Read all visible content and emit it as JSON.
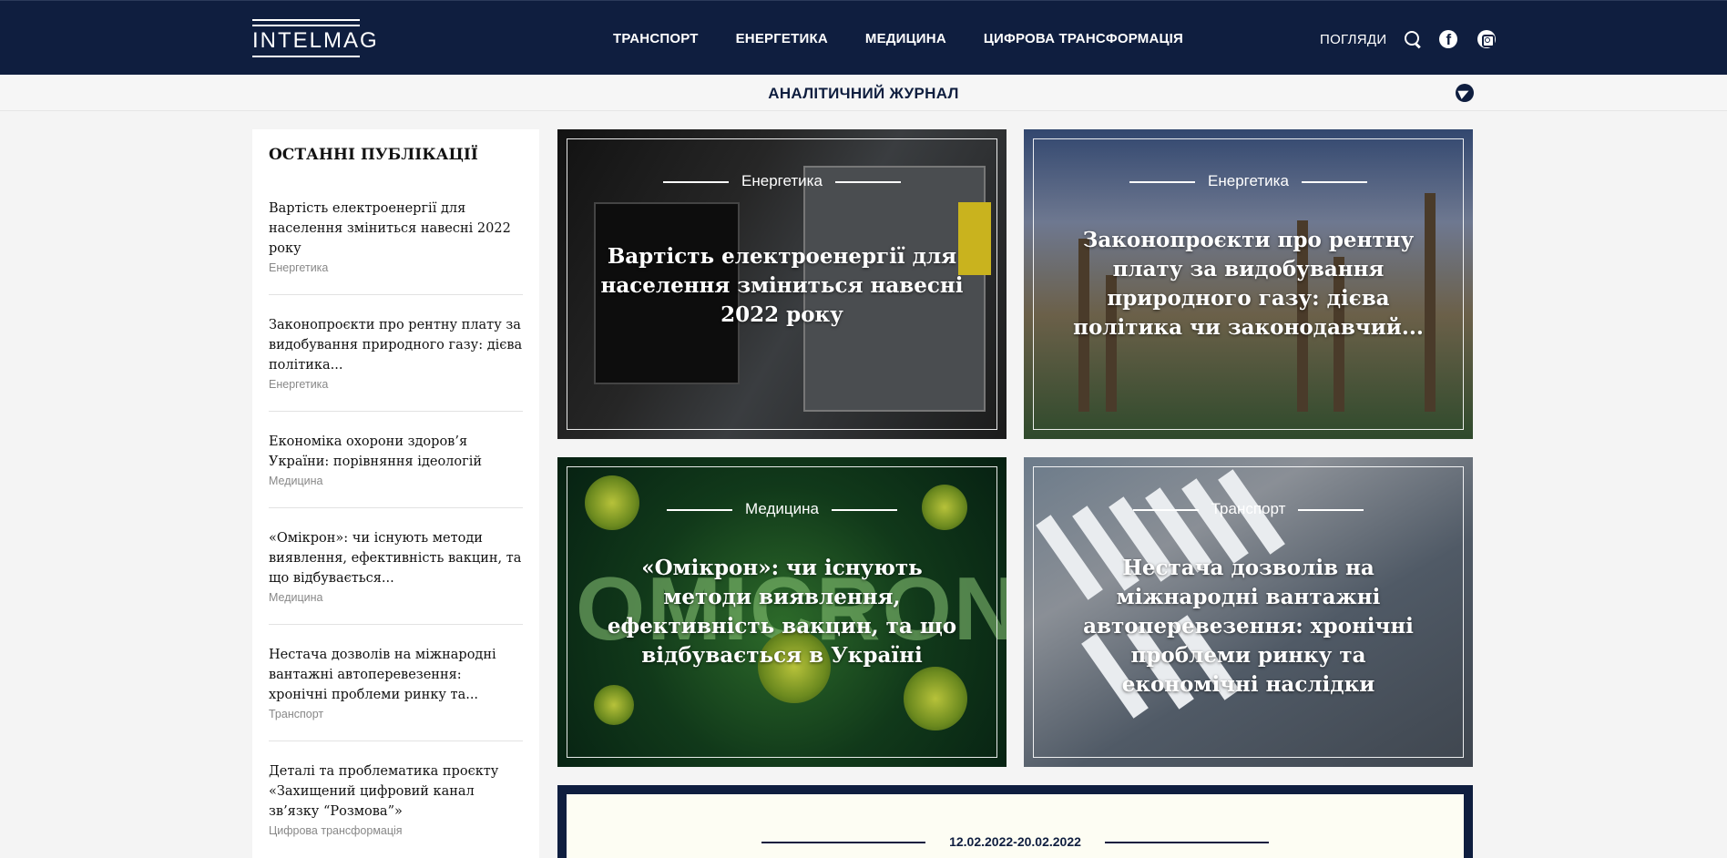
{
  "header": {
    "logo_text": "INTELMAG",
    "nav": [
      "ТРАНСПОРТ",
      "ЕНЕРГЕТИКА",
      "МЕДИЦИНА",
      "ЦИФРОВА ТРАНСФОРМАЦІЯ"
    ],
    "views_label": "ПОГЛЯДИ",
    "icons": [
      "search-icon",
      "facebook-icon",
      "instagram-icon"
    ]
  },
  "subheader": {
    "title": "АНАЛІТИЧНИЙ ЖУРНАЛ",
    "icon": "telegram-icon"
  },
  "sidebar": {
    "title": "ОСТАННІ ПУБЛІКАЦІЇ",
    "items": [
      {
        "title": "Вартість електроенергії для населення зміниться навесні 2022 року",
        "category": "Енергетика"
      },
      {
        "title": "Законопроєкти про рентну плату за видобування природного газу: дієва політика...",
        "category": "Енергетика"
      },
      {
        "title": "Економіка охорони здоров’я України: порівняння ідеологій",
        "category": "Медицина"
      },
      {
        "title": "«Омікрон»: чи існують методи виявлення, ефективність вакцин, та що відбувається...",
        "category": "Медицина"
      },
      {
        "title": "Нестача дозволів на міжнародні вантажні автоперевезення: хронічні проблеми ринку та...",
        "category": "Транспорт"
      },
      {
        "title": "Деталі та проблематика проєкту «Захищений цифровий канал зв’язку “Розмова”»",
        "category": "Цифрова трансформація"
      }
    ]
  },
  "cards": [
    {
      "category": "Енергетика",
      "title": "Вартість електроенергії для населення зміниться навесні 2022 року"
    },
    {
      "category": "Енергетика",
      "title": "Законопроєкти про рентну плату за видобування природного газу: дієва політика чи законодавчий..."
    },
    {
      "category": "Медицина",
      "title": "«Омікрон»: чи існують методи виявлення, ефективність вакцин, та що відбувається в Україні"
    },
    {
      "category": "Транспорт",
      "title": "Нестача дозволів на міжнародні вантажні автоперевезення: хронічні проблеми ринку та економічні наслідки"
    }
  ],
  "card_image_texts": {
    "omicron_word": "OMICRON"
  },
  "weekly": {
    "date_range": "12.02.2022-20.02.2022"
  },
  "colors": {
    "header_bg": "#0f1e3f",
    "accent": "#0f1e3f",
    "page_bg": "#f4f4f4"
  }
}
